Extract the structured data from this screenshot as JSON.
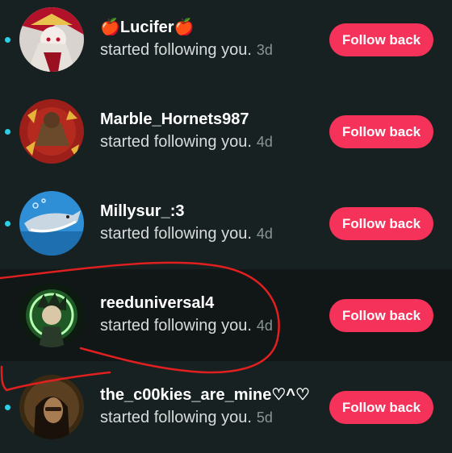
{
  "followers": [
    {
      "name": "🍎Lucifer🍎",
      "action": "started following you.",
      "time": "3d",
      "button": "Follow back",
      "unread": true,
      "highlighted": false,
      "avatar": "lucifer-avatar"
    },
    {
      "name": "Marble_Hornets987",
      "action": "started following you.",
      "time": "4d",
      "button": "Follow back",
      "unread": true,
      "highlighted": false,
      "avatar": "hornets-avatar"
    },
    {
      "name": "Millysur_:3",
      "action": "started following you.",
      "time": "4d",
      "button": "Follow back",
      "unread": true,
      "highlighted": false,
      "avatar": "shark-avatar"
    },
    {
      "name": "reeduniversal4",
      "action": "started following you.",
      "time": "4d",
      "button": "Follow back",
      "unread": false,
      "highlighted": true,
      "avatar": "green-glow-avatar"
    },
    {
      "name": "the_c00kies_are_mine♡^♡",
      "action": "started following you.",
      "time": "5d",
      "button": "Follow back",
      "unread": true,
      "highlighted": false,
      "avatar": "portrait-avatar"
    }
  ],
  "colors": {
    "background": "#172121",
    "highlight_row": "#111616",
    "button": "#f5335a",
    "unread_dot": "#2bd0e6",
    "annotation": "#e02020"
  }
}
